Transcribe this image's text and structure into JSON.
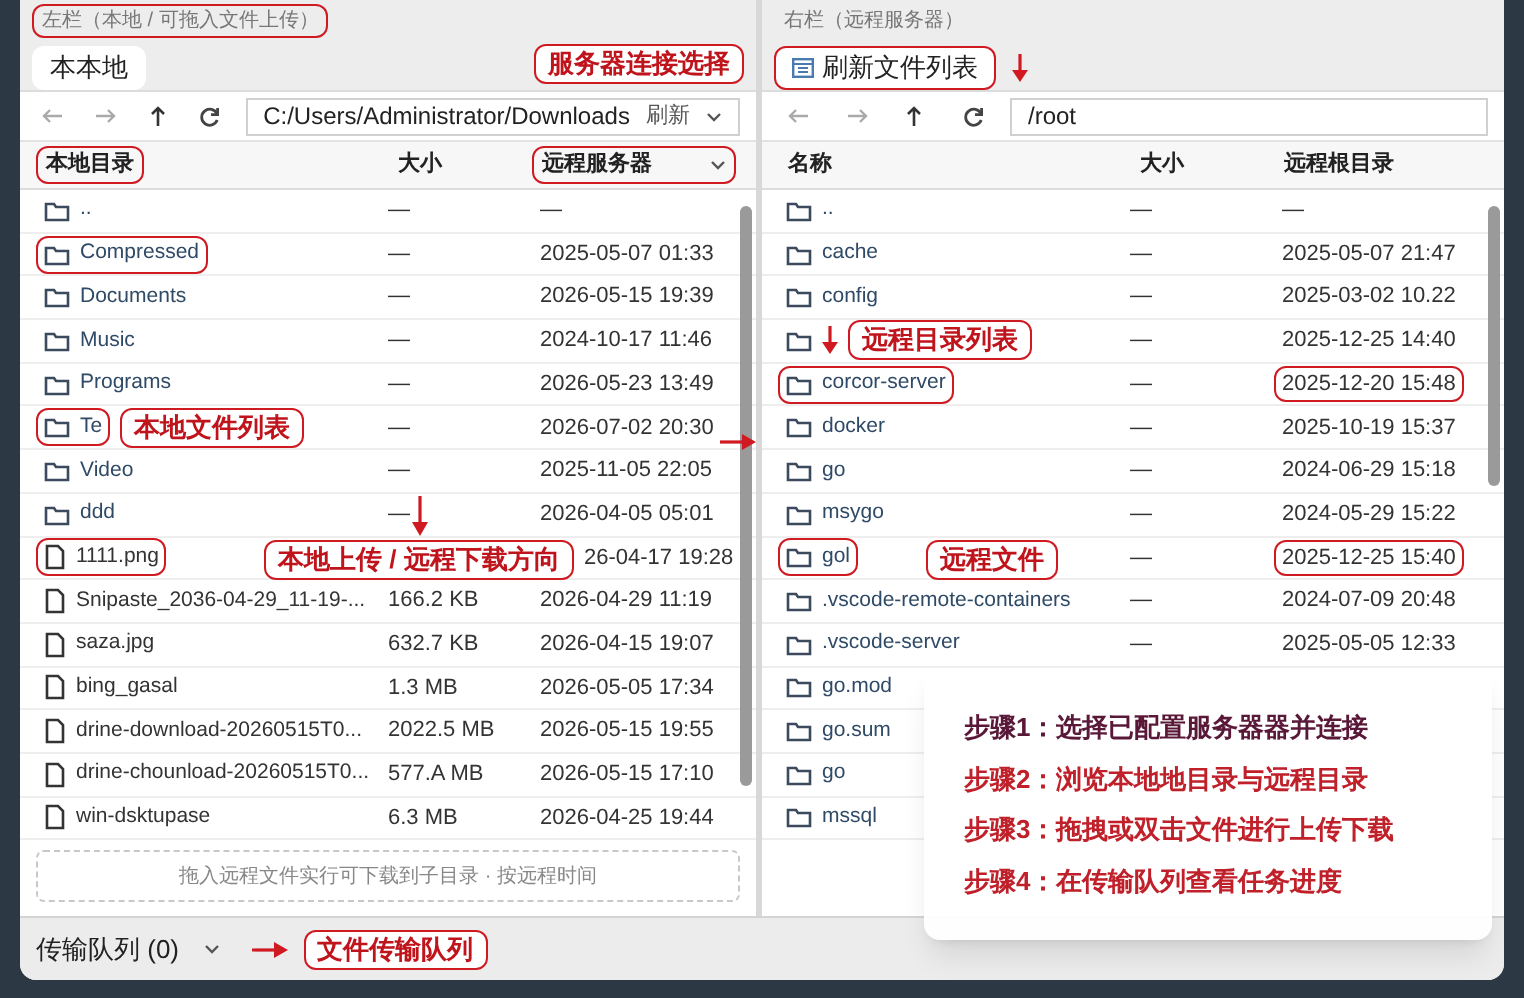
{
  "panes": [
    {
      "caption": {
        "text": "左栏（本地 / 可拖入文件上传）",
        "highlighted": true
      },
      "tabs": [
        {
          "label": "本本地",
          "selected": true,
          "highlighted": false,
          "icon": false
        }
      ],
      "tab_callout": {
        "text": "服务器连接选择"
      },
      "path": "C:/Users/Administrator/Downloads",
      "refresh_label": "刷新",
      "path_dropdown": true,
      "columns": [
        {
          "label": "本地目录",
          "highlighted": true,
          "dropdown": false
        },
        {
          "label": "大小",
          "highlighted": false,
          "dropdown": false
        },
        {
          "label": "远程服务器",
          "highlighted": true,
          "dropdown": true
        }
      ],
      "rows": [
        {
          "kind": "folder",
          "name": "..",
          "size": "—",
          "date": "—",
          "name_highlighted": false,
          "date_highlighted": false
        },
        {
          "kind": "folder",
          "name": "Compressed",
          "size": "—",
          "date": "2025-05-07 01:33",
          "name_highlighted": true,
          "date_highlighted": false
        },
        {
          "kind": "folder",
          "name": "Documents",
          "size": "—",
          "date": "2026-05-15 19:39",
          "name_highlighted": false,
          "date_highlighted": false
        },
        {
          "kind": "folder",
          "name": "Music",
          "size": "—",
          "date": "2024-10-17 11:46",
          "name_highlighted": false,
          "date_highlighted": false
        },
        {
          "kind": "folder",
          "name": "Programs",
          "size": "—",
          "date": "2026-05-23 13:49",
          "name_highlighted": false,
          "date_highlighted": false
        },
        {
          "kind": "folder",
          "name": "Te",
          "size": "—",
          "date": "2026-07-02 20:30",
          "name_highlighted": true,
          "date_highlighted": false,
          "callout": {
            "text": "本地文件列表",
            "arrow": true
          }
        },
        {
          "kind": "folder",
          "name": "Video",
          "size": "—",
          "date": "2025-11-05 22:05",
          "name_highlighted": false,
          "date_highlighted": false
        },
        {
          "kind": "folder",
          "name": "ddd",
          "size": "—",
          "date": "2026-04-05 05:01",
          "name_highlighted": false,
          "date_highlighted": false
        },
        {
          "kind": "file",
          "name": "1111.png",
          "date": "26-04-17 19:28",
          "name_highlighted": true,
          "date_highlighted": false,
          "callout": {
            "text": "本地上传 / 远程下载方向",
            "arrow": true
          }
        },
        {
          "kind": "file",
          "name": "Snipaste_2036-04-29_11-19-...",
          "size": "166.2 KB",
          "date": "2026-04-29 11:19",
          "name_highlighted": false,
          "date_highlighted": false
        },
        {
          "kind": "file",
          "name": "saza.jpg",
          "size": "632.7 KB",
          "date": "2026-04-15 19:07",
          "name_highlighted": false,
          "date_highlighted": false
        },
        {
          "kind": "file",
          "name": "bing_gasal",
          "size": "1.3 MB",
          "date": "2026-05-05 17:34",
          "name_highlighted": false,
          "date_highlighted": false
        },
        {
          "kind": "file",
          "name": "drine-download-20260515T0...",
          "size": "2022.5 MB",
          "date": "2026-05-15 19:55",
          "name_highlighted": false,
          "date_highlighted": false
        },
        {
          "kind": "file",
          "name": "drine-chounload-20260515T0...",
          "size": "577.A MB",
          "date": "2026-05-15 17:10",
          "name_highlighted": false,
          "date_highlighted": false
        },
        {
          "kind": "file",
          "name": "win-dsktupase",
          "size": "6.3 MB",
          "date": "2026-04-25 19:44",
          "name_highlighted": false,
          "date_highlighted": false
        }
      ],
      "drop_hint": "拖入远程文件实行可下载到子目录 · 按远程时间"
    },
    {
      "caption": {
        "text": "右栏（远程服务器）",
        "highlighted": false
      },
      "tabs": [
        {
          "label": "刷新文件列表",
          "selected": true,
          "highlighted": true,
          "icon": true,
          "arrow": true
        }
      ],
      "path": "/root",
      "path_dropdown": false,
      "columns": [
        {
          "label": "名称",
          "highlighted": false,
          "dropdown": false
        },
        {
          "label": "大小",
          "highlighted": false,
          "dropdown": false
        },
        {
          "label": "远程根目录",
          "highlighted": false,
          "dropdown": false
        }
      ],
      "rows": [
        {
          "kind": "folder",
          "name": "..",
          "size": "—",
          "date": "—",
          "name_highlighted": false,
          "date_highlighted": false
        },
        {
          "kind": "folder",
          "name": "cache",
          "size": "—",
          "date": "2025-05-07 21:47",
          "name_highlighted": false,
          "date_highlighted": false
        },
        {
          "kind": "folder",
          "name": "config",
          "size": "—",
          "date": "2025-03-02 10.22",
          "name_highlighted": false,
          "date_highlighted": false
        },
        {
          "kind": "folder",
          "size": "—",
          "date": "2025-12-25 14:40",
          "name_highlighted": false,
          "date_highlighted": false,
          "callout": {
            "text": "远程目录列表",
            "arrow": true
          }
        },
        {
          "kind": "folder",
          "name": "corcor-server",
          "size": "—",
          "date": "2025-12-20 15:48",
          "name_highlighted": true,
          "date_highlighted": true
        },
        {
          "kind": "folder",
          "name": "docker",
          "size": "—",
          "date": "2025-10-19 15:37",
          "name_highlighted": false,
          "date_highlighted": false
        },
        {
          "kind": "folder",
          "name": "go",
          "size": "—",
          "date": "2024-06-29 15:18",
          "name_highlighted": false,
          "date_highlighted": false
        },
        {
          "kind": "folder",
          "name": "msygo",
          "size": "—",
          "date": "2024-05-29 15:22",
          "name_highlighted": false,
          "date_highlighted": false
        },
        {
          "kind": "folder",
          "name": "gol",
          "size": "—",
          "date": "2025-12-25 15:40",
          "name_highlighted": true,
          "date_highlighted": true,
          "callout": {
            "text": "远程文件"
          }
        },
        {
          "kind": "folder",
          "name": ".vscode-remote-containers",
          "size": "—",
          "date": "2024-07-09 20:48",
          "name_highlighted": false,
          "date_highlighted": false
        },
        {
          "kind": "folder",
          "name": ".vscode-server",
          "size": "—",
          "date": "2025-05-05 12:33",
          "name_highlighted": false,
          "date_highlighted": false
        },
        {
          "kind": "folder",
          "name": "go.mod",
          "name_highlighted": false
        },
        {
          "kind": "folder",
          "name": "go.sum",
          "name_highlighted": false
        },
        {
          "kind": "folder",
          "name": "go",
          "name_highlighted": false
        },
        {
          "kind": "folder",
          "name": "mssql",
          "name_highlighted": false
        }
      ]
    }
  ],
  "status_bar": {
    "queue_label": "传输队列 (0)",
    "callout": {
      "text": "文件传输队列",
      "arrow": true
    }
  },
  "steps": [
    {
      "text": "步骤1：选择已配置服务器器并连接",
      "color": "#5a1838"
    },
    {
      "text": "步骤2：浏览本地地目录与远程目录",
      "color": "#c0202a"
    },
    {
      "text": "步骤3：拖拽或双击文件进行上传下载",
      "color": "#c0202a"
    },
    {
      "text": "步骤4：在传输队列查看任务进度",
      "color": "#c0202a"
    }
  ]
}
